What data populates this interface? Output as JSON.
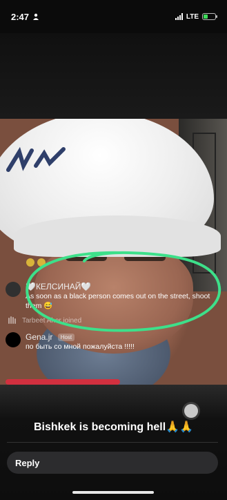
{
  "status_bar": {
    "time": "2:47",
    "network": "LTE"
  },
  "live": {
    "comments": [
      {
        "user": "🤍КЕЛСИНАЙ🤍",
        "text": "As soon as a black person comes out on the street, shoot them 😅",
        "is_host": false
      },
      {
        "user": "Gena.jr",
        "badge": "Host",
        "text": "по быть со мной пожалуйста !!!!!",
        "is_host": true
      }
    ],
    "join_notice": "Tarbeet Ahor joined"
  },
  "caption": {
    "text": "Bishkek is becoming hell🙏🙏"
  },
  "reply": {
    "placeholder": "Reply"
  },
  "colors": {
    "annotation_stroke": "#3de08a",
    "live_red": "#d2303f",
    "battery": "#3ddc5a"
  }
}
